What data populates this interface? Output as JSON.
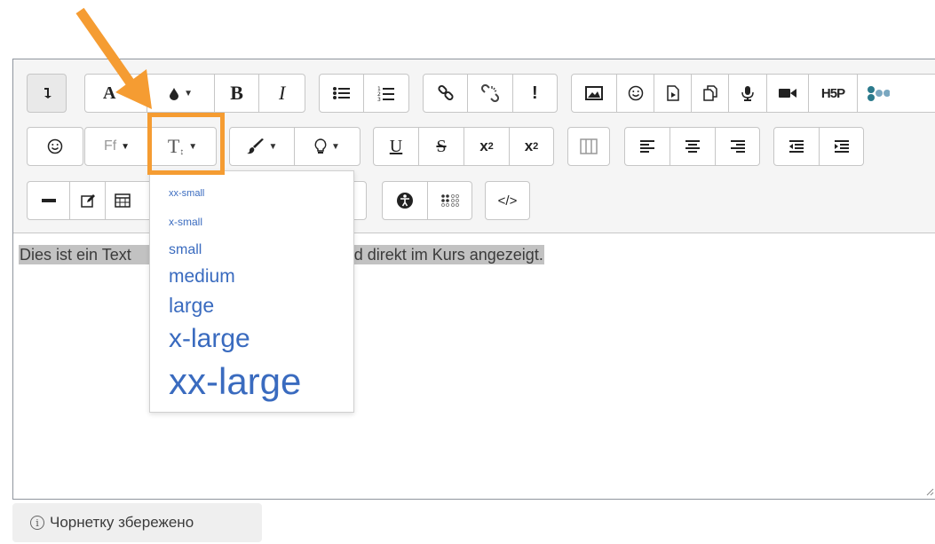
{
  "toolbar": {
    "row1": {
      "bold_label": "B",
      "italic_label": "I",
      "accessibility_label": "!",
      "h5p_label": "H5P",
      "font_color_label": "A"
    },
    "row2": {
      "font_family_label": "Ff",
      "underline_label": "U",
      "strike_label": "S",
      "subscript_label": "x",
      "subscript_sub": "2",
      "superscript_label": "x",
      "superscript_sup": "2"
    },
    "row3": {
      "html_label": "</>"
    }
  },
  "font_size_menu": {
    "items": [
      {
        "label": "xx-small"
      },
      {
        "label": "x-small"
      },
      {
        "label": "small"
      },
      {
        "label": "medium"
      },
      {
        "label": "large"
      },
      {
        "label": "x-large"
      },
      {
        "label": "xx-large"
      }
    ]
  },
  "content": {
    "text_left": "Dies ist ein Text",
    "text_right": "d wird direkt im Kurs angezeigt."
  },
  "status": {
    "draft_saved": "Чорнетку збережено"
  },
  "colors": {
    "highlight": "#f59c32",
    "link_blue": "#3a6bbf"
  }
}
